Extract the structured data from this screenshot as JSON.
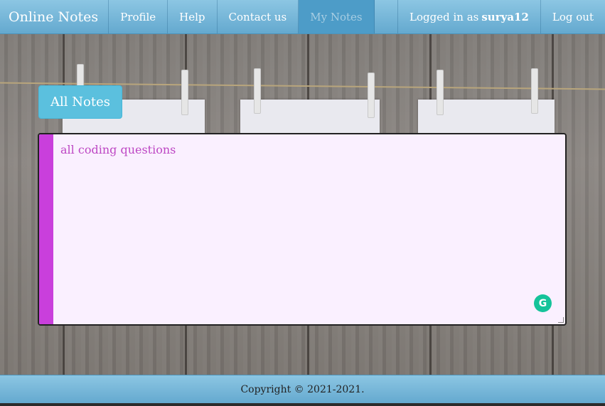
{
  "navbar": {
    "brand": "Online Notes",
    "items": [
      {
        "label": "Profile"
      },
      {
        "label": "Help"
      },
      {
        "label": "Contact us"
      },
      {
        "label": "My Notes",
        "active": true
      }
    ],
    "logged_in_prefix": "Logged in as",
    "username": "surya12",
    "logout_label": "Log out"
  },
  "main": {
    "all_notes_label": "All Notes",
    "note_text": "all coding questions"
  },
  "footer": {
    "copyright": "Copyright © 2021-2021."
  },
  "icons": {
    "grammarly": "grammarly-icon"
  },
  "colors": {
    "navbar": "#64a9cf",
    "button": "#5bc0de",
    "note_bar": "#c93fdc",
    "note_bg": "#faf0ff",
    "note_text": "#bd47c4"
  }
}
